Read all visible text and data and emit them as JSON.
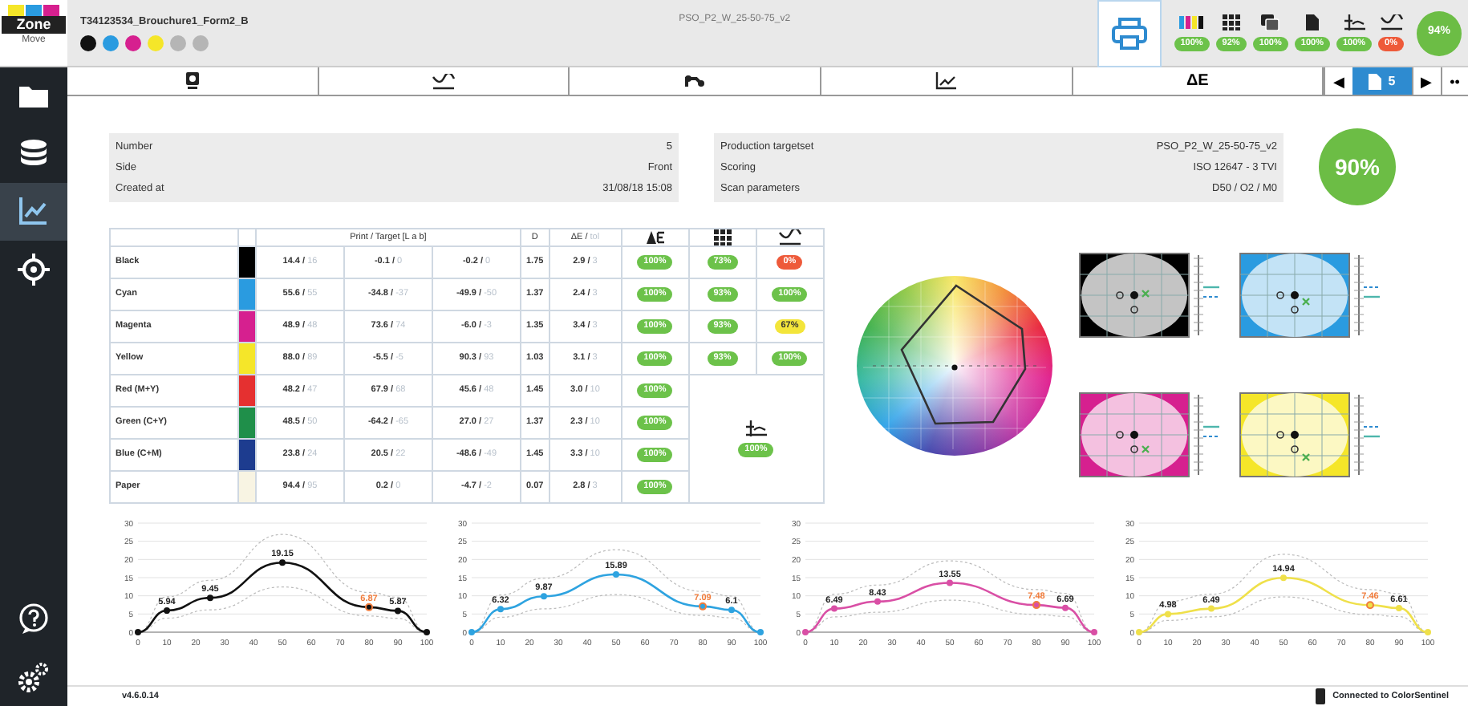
{
  "logo": {
    "word": "Zone",
    "sub": "Move"
  },
  "header": {
    "title": "T34123534_Brouchure1_Form2_B",
    "inks": [
      {
        "color": "#111111"
      },
      {
        "color": "#2a9be0"
      },
      {
        "color": "#d6208f"
      },
      {
        "color": "#f5e629"
      },
      {
        "color": "#b5b5b5"
      },
      {
        "color": "#b5b5b5"
      }
    ],
    "targetset": "PSO_P2_W_25-50-75_v2",
    "stats": [
      {
        "kind": "ink",
        "text": "100%",
        "color": "#6cc24a"
      },
      {
        "kind": "grid",
        "text": "92%",
        "color": "#6cc24a"
      },
      {
        "kind": "overlap",
        "text": "100%",
        "color": "#6cc24a"
      },
      {
        "kind": "paper",
        "text": "100%",
        "color": "#6cc24a"
      },
      {
        "kind": "balance",
        "text": "100%",
        "color": "#6cc24a"
      },
      {
        "kind": "tvi",
        "text": "0%",
        "color": "#ee5a3a"
      }
    ],
    "score": "94%"
  },
  "sidebar": {
    "items": [
      {
        "kind": "folder",
        "selected": false
      },
      {
        "kind": "database",
        "selected": false
      },
      {
        "kind": "chart",
        "selected": true
      },
      {
        "kind": "crosshair",
        "selected": false
      }
    ]
  },
  "tabs": [
    {
      "kind": "target"
    },
    {
      "kind": "tvi"
    },
    {
      "kind": "network"
    },
    {
      "kind": "chart"
    },
    {
      "kind": "text",
      "label": "ΔE"
    }
  ],
  "pager": {
    "prev": "◀",
    "page": "5",
    "next": "▶",
    "more": "••"
  },
  "info": {
    "left": [
      {
        "label": "Number",
        "value": "5"
      },
      {
        "label": "Side",
        "value": "Front"
      },
      {
        "label": "Created at",
        "value": "31/08/18 15:08"
      }
    ],
    "right": [
      {
        "label": "Production targetset",
        "value": "PSO_P2_W_25-50-75_v2"
      },
      {
        "label": "Scoring",
        "value": "ISO 12647 - 3 TVI"
      },
      {
        "label": "Scan parameters",
        "value": "D50 / O2 / M0"
      }
    ],
    "score": "90%"
  },
  "table": {
    "header": "Print / Target [L a b]",
    "d": "D",
    "de": "ΔE / ",
    "de_tol": "tol",
    "icons": [
      {
        "kind": "delta-e"
      },
      {
        "kind": "grid"
      },
      {
        "kind": "tvi"
      }
    ],
    "rows": [
      {
        "name": "Black",
        "color": "#000000",
        "l": [
          "14.4 /",
          "16"
        ],
        "a": [
          "-0.1 /",
          "0"
        ],
        "b": [
          "-0.2 /",
          "0"
        ],
        "d": "1.75",
        "de": [
          "2.9 /",
          "3"
        ],
        "badges": [
          {
            "text": "100%",
            "color": "#6cc24a"
          },
          {
            "text": "73%",
            "color": "#6cc24a"
          },
          {
            "text": "0%",
            "color": "#ee5a3a"
          }
        ]
      },
      {
        "name": "Cyan",
        "color": "#2a9be0",
        "l": [
          "55.6 /",
          "55"
        ],
        "a": [
          "-34.8 /",
          "-37"
        ],
        "b": [
          "-49.9 /",
          "-50"
        ],
        "d": "1.37",
        "de": [
          "2.4 /",
          "3"
        ],
        "badges": [
          {
            "text": "100%",
            "color": "#6cc24a"
          },
          {
            "text": "93%",
            "color": "#6cc24a"
          },
          {
            "text": "100%",
            "color": "#6cc24a"
          }
        ]
      },
      {
        "name": "Magenta",
        "color": "#d6208f",
        "l": [
          "48.9 /",
          "48"
        ],
        "a": [
          "73.6 /",
          "74"
        ],
        "b": [
          "-6.0 /",
          "-3"
        ],
        "d": "1.35",
        "de": [
          "3.4 /",
          "3"
        ],
        "badges": [
          {
            "text": "100%",
            "color": "#6cc24a"
          },
          {
            "text": "93%",
            "color": "#6cc24a"
          },
          {
            "text": "67%",
            "color": "#f3e53a"
          }
        ]
      },
      {
        "name": "Yellow",
        "color": "#f5e629",
        "l": [
          "88.0 /",
          "89"
        ],
        "a": [
          "-5.5 /",
          "-5"
        ],
        "b": [
          "90.3 /",
          "93"
        ],
        "d": "1.03",
        "de": [
          "3.1 /",
          "3"
        ],
        "badges": [
          {
            "text": "100%",
            "color": "#6cc24a"
          },
          {
            "text": "93%",
            "color": "#6cc24a"
          },
          {
            "text": "100%",
            "color": "#6cc24a"
          }
        ]
      },
      {
        "name": "Red (M+Y)",
        "color": "#e53030",
        "l": [
          "48.2 /",
          "47"
        ],
        "a": [
          "67.9 /",
          "68"
        ],
        "b": [
          "45.6 /",
          "48"
        ],
        "d": "1.45",
        "de": [
          "3.0 /",
          "10"
        ],
        "badges": [
          {
            "text": "100%",
            "color": "#6cc24a"
          }
        ]
      },
      {
        "name": "Green (C+Y)",
        "color": "#1f8f4a",
        "l": [
          "48.5 /",
          "50"
        ],
        "a": [
          "-64.2 /",
          "-65"
        ],
        "b": [
          "27.0 /",
          "27"
        ],
        "d": "1.37",
        "de": [
          "2.3 /",
          "10"
        ],
        "badges": [
          {
            "text": "100%",
            "color": "#6cc24a"
          }
        ]
      },
      {
        "name": "Blue (C+M)",
        "color": "#1d3c8f",
        "l": [
          "23.8 /",
          "24"
        ],
        "a": [
          "20.5 /",
          "22"
        ],
        "b": [
          "-48.6 /",
          "-49"
        ],
        "d": "1.45",
        "de": [
          "3.3 /",
          "10"
        ],
        "badges": [
          {
            "text": "100%",
            "color": "#6cc24a"
          }
        ]
      },
      {
        "name": "Paper",
        "color": "#f8f4e3",
        "l": [
          "94.4 /",
          "95"
        ],
        "a": [
          "0.2 /",
          "0"
        ],
        "b": [
          "-4.7 /",
          "-2"
        ],
        "d": "0.07",
        "de": [
          "2.8 /",
          "3"
        ],
        "badges": [
          {
            "text": "100%",
            "color": "#6cc24a"
          }
        ]
      }
    ],
    "merged": {
      "kind": "balance",
      "text": "100%",
      "color": "#6cc24a"
    }
  },
  "targets": [
    {
      "color": "#000000"
    },
    {
      "color": "#2a9be0"
    },
    {
      "color": "#d6208f"
    },
    {
      "color": "#f5e629"
    }
  ],
  "charts": [
    {
      "flagged": [
        false,
        false,
        false,
        false,
        true,
        false,
        false
      ],
      "chart_data": {
        "type": "line",
        "grid": true,
        "x": [
          0,
          10,
          25,
          50,
          80,
          90,
          100
        ],
        "series": [
          {
            "color": "#111111",
            "marker": "circle",
            "values": [
              0,
              5.94,
              9.45,
              19.15,
              6.87,
              5.87,
              0
            ]
          }
        ],
        "xticks": [
          0,
          10,
          20,
          30,
          40,
          50,
          60,
          70,
          80,
          90,
          100
        ],
        "yticks": [
          0,
          5,
          10,
          15,
          20,
          25,
          30
        ],
        "xlim": [
          0,
          100
        ],
        "ylim": [
          0,
          30
        ],
        "value_labels": [
          null,
          "5.94",
          "9.45",
          "19.15",
          "6.87",
          "5.87",
          null
        ]
      }
    },
    {
      "flagged": [
        false,
        false,
        false,
        false,
        true,
        false,
        false
      ],
      "chart_data": {
        "type": "line",
        "grid": true,
        "x": [
          0,
          10,
          25,
          50,
          80,
          90,
          100
        ],
        "series": [
          {
            "color": "#2ea3e0",
            "marker": "circle",
            "values": [
              0,
              6.32,
              9.87,
              15.89,
              7.09,
              6.1,
              0
            ]
          }
        ],
        "xticks": [
          0,
          10,
          20,
          30,
          40,
          50,
          60,
          70,
          80,
          90,
          100
        ],
        "yticks": [
          0,
          5,
          10,
          15,
          20,
          25,
          30
        ],
        "xlim": [
          0,
          100
        ],
        "ylim": [
          0,
          30
        ],
        "value_labels": [
          null,
          "6.32",
          "9.87",
          "15.89",
          "7.09",
          "6.1",
          null
        ]
      }
    },
    {
      "flagged": [
        false,
        false,
        false,
        false,
        true,
        false,
        false
      ],
      "chart_data": {
        "type": "line",
        "grid": true,
        "x": [
          0,
          10,
          25,
          50,
          80,
          90,
          100
        ],
        "series": [
          {
            "color": "#d94fa5",
            "marker": "circle",
            "values": [
              0,
              6.49,
              8.43,
              13.55,
              7.48,
              6.69,
              0
            ]
          }
        ],
        "xticks": [
          0,
          10,
          20,
          30,
          40,
          50,
          60,
          70,
          80,
          90,
          100
        ],
        "yticks": [
          0,
          5,
          10,
          15,
          20,
          25,
          30
        ],
        "xlim": [
          0,
          100
        ],
        "ylim": [
          0,
          30
        ],
        "value_labels": [
          null,
          "6.49",
          "8.43",
          "13.55",
          "7.48",
          "6.69",
          null
        ]
      }
    },
    {
      "flagged": [
        false,
        false,
        false,
        false,
        true,
        false,
        false
      ],
      "chart_data": {
        "type": "line",
        "grid": true,
        "x": [
          0,
          10,
          25,
          50,
          80,
          90,
          100
        ],
        "series": [
          {
            "color": "#efe04a",
            "marker": "circle",
            "values": [
              0,
              4.98,
              6.49,
              14.94,
              7.46,
              6.61,
              0
            ]
          }
        ],
        "xticks": [
          0,
          10,
          20,
          30,
          40,
          50,
          60,
          70,
          80,
          90,
          100
        ],
        "yticks": [
          0,
          5,
          10,
          15,
          20,
          25,
          30
        ],
        "xlim": [
          0,
          100
        ],
        "ylim": [
          0,
          30
        ],
        "value_labels": [
          null,
          "4.98",
          "6.49",
          "14.94",
          "7.46",
          "6.61",
          null
        ]
      }
    }
  ],
  "status_bar": {
    "version": "v4.6.0.14",
    "connection": "Connected to ColorSentinel"
  }
}
